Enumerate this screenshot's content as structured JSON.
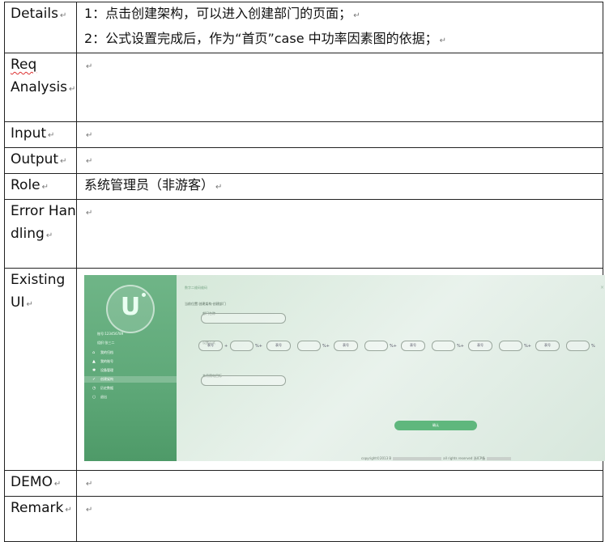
{
  "table": {
    "details_label": "Details",
    "details_line1": "1：点击创建架构，可以进入创建部门的页面；",
    "details_line2": "2：公式设置完成后，作为“首页”case 中功率因素图的依据；",
    "req_label_1": "Req",
    "req_label_2": "Analysis",
    "input_label": "Input",
    "output_label": "Output",
    "role_label": "Role",
    "role_value": "系统管理员（非游客）",
    "error_label": "Error Handling",
    "existing_label": "Existing UI",
    "demo_label": "DEMO",
    "remark_label": "Remark",
    "para_mark": "↵"
  },
  "screenshot": {
    "logo_letter": "U",
    "account": "账号:123456789",
    "org": "组织:张三二",
    "menu": [
      {
        "icon": "home-icon",
        "glyph": "⌂",
        "label": "我的归档"
      },
      {
        "icon": "user-icon",
        "glyph": "▲",
        "label": "我的账号"
      },
      {
        "icon": "gear-icon",
        "glyph": "✱",
        "label": "设备管理"
      },
      {
        "icon": "check-icon",
        "glyph": "✓",
        "label": "创建架构"
      },
      {
        "icon": "clock-icon",
        "glyph": "◷",
        "label": "历史数据"
      },
      {
        "icon": "exit-icon",
        "glyph": "○",
        "label": "退出"
      }
    ],
    "title": "数字二维码维码",
    "breadcrumb": "当前位置:创建架构-创建部门",
    "dept_name_label": "部门名称",
    "formula_label": "设置公式",
    "formula_select_text": "表号",
    "formula_ops": [
      "+",
      "%+",
      "%+",
      "%+",
      "%+",
      "%+",
      "%+",
      "%"
    ],
    "month_target_label": "本月用电目标",
    "confirm_button": "确认",
    "copyright_prefix": "copyright©2013 B",
    "copyright_mid": "all rights reserved 浙ICP备",
    "close_glyph": "×"
  }
}
